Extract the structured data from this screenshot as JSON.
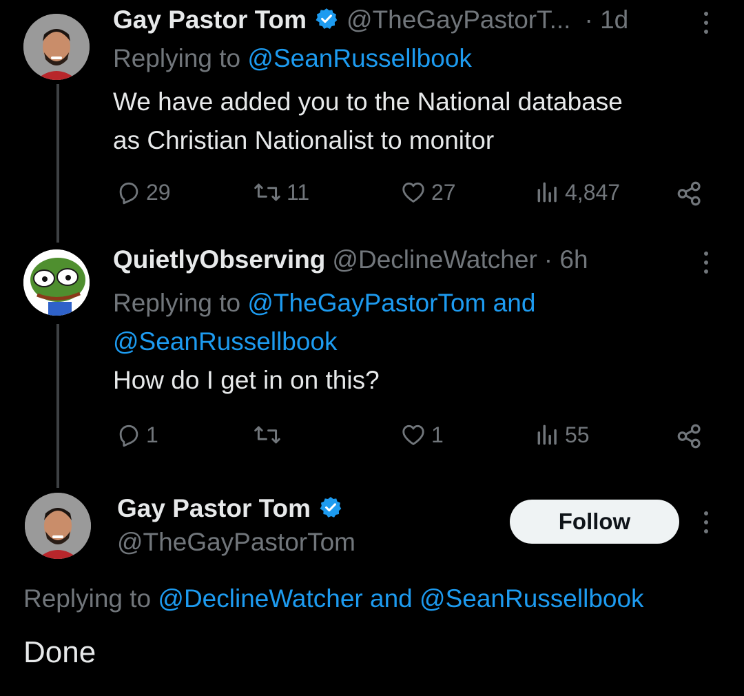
{
  "tweets": [
    {
      "name": "Gay Pastor Tom",
      "handle": "@TheGayPastorT...",
      "time": "· 1d",
      "replying_prefix": "Replying to",
      "replying_to": "@SeanRussellbook",
      "text_lines": [
        "We have added you to the National database",
        "as Christian Nationalist to monitor"
      ],
      "replies": "29",
      "retweets": "11",
      "likes": "27",
      "views": "4,847"
    },
    {
      "name": "QuietlyObserving",
      "handle": "@DeclineWatcher",
      "time": "· 6h",
      "replying_prefix": "Replying to",
      "replying_to_line1": "@TheGayPastorTom and",
      "replying_to_line2": "@SeanRussellbook",
      "text": "How do I get in on this?",
      "replies": "1",
      "retweets": "",
      "likes": "1",
      "views": "55"
    }
  ],
  "focused": {
    "name": "Gay Pastor Tom",
    "handle": "@TheGayPastorTom",
    "follow_label": "Follow",
    "replying_prefix": "Replying to",
    "replying_to_a": "@DeclineWatcher",
    "and_word": "and",
    "replying_to_b": "@SeanRussellbook",
    "text": "Done"
  },
  "colors": {
    "background": "#000000",
    "text": "#e7e9ea",
    "muted": "#71767b",
    "accent": "#1d9bf0",
    "verified": "#1d9bf0"
  },
  "icons": [
    "verified-badge-icon",
    "more-icon",
    "reply-icon",
    "retweet-icon",
    "like-icon",
    "views-icon",
    "share-icon"
  ]
}
